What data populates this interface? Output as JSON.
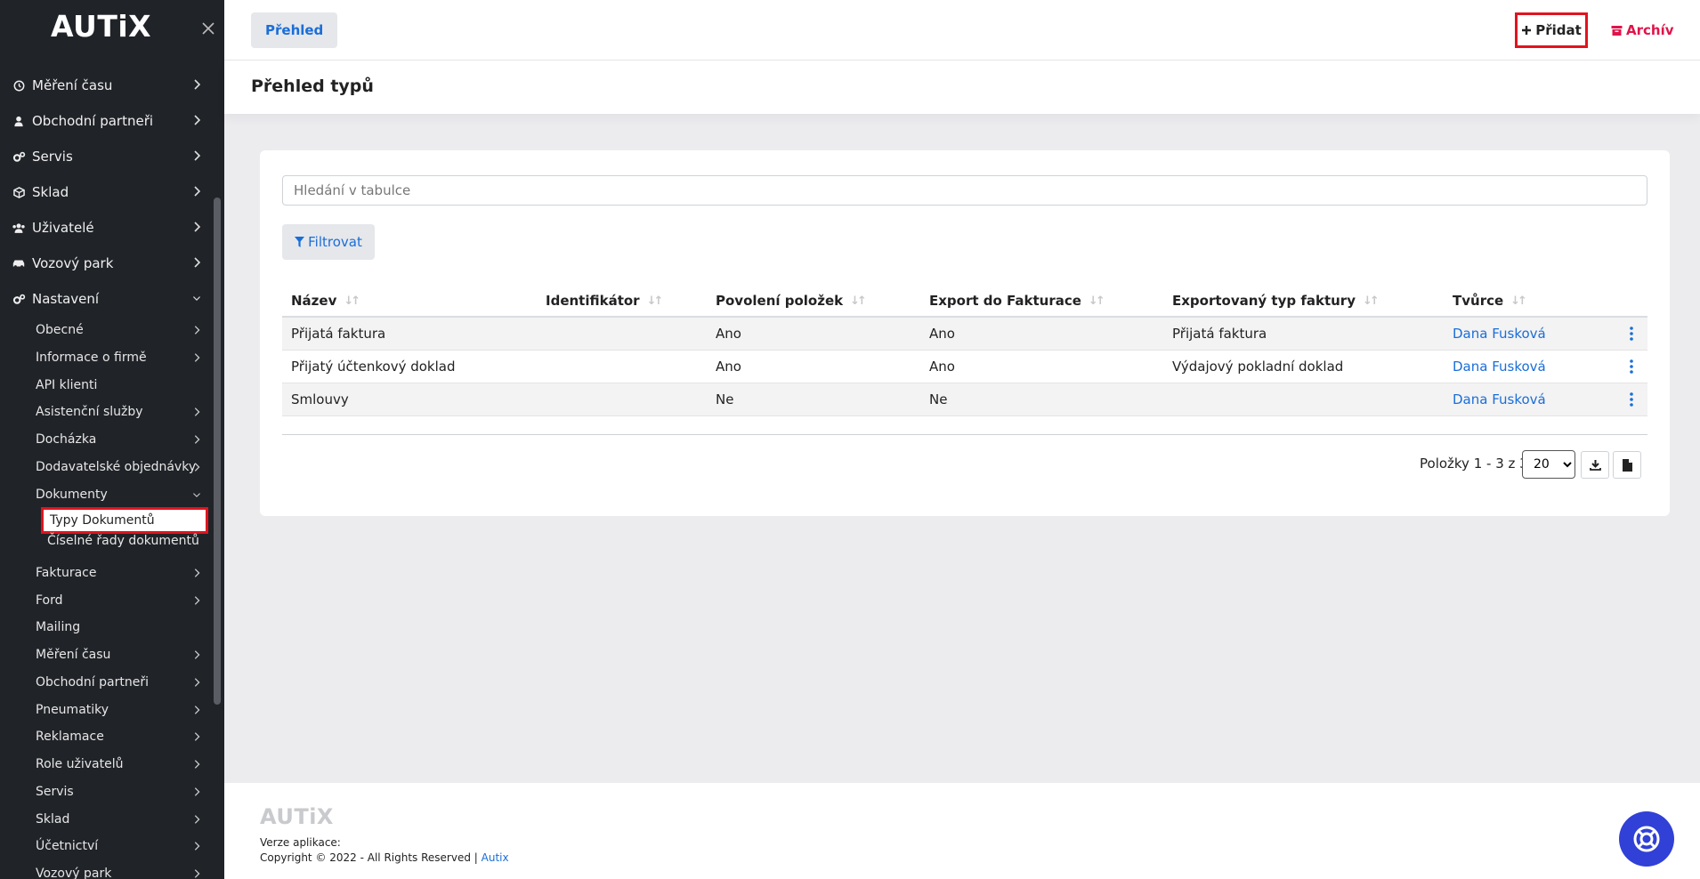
{
  "app": {
    "logo": "AUTiX"
  },
  "sidebar": {
    "items": [
      {
        "label": "Měření času",
        "icon": "clock-icon"
      },
      {
        "label": "Obchodní partneři",
        "icon": "user-icon"
      },
      {
        "label": "Servis",
        "icon": "cogs-icon"
      },
      {
        "label": "Sklad",
        "icon": "box-icon"
      },
      {
        "label": "Uživatelé",
        "icon": "users-icon"
      },
      {
        "label": "Vozový park",
        "icon": "car-icon"
      },
      {
        "label": "Nastavení",
        "icon": "cogs-icon"
      }
    ],
    "settings_sub": [
      "Obecné",
      "Informace o firmě",
      "API klienti",
      "Asistenční služby",
      "Docházka",
      "Dodavatelské objednávky",
      "Dokumenty",
      "Fakturace",
      "Ford",
      "Mailing",
      "Měření času",
      "Obchodní partneři",
      "Pneumatiky",
      "Reklamace",
      "Role uživatelů",
      "Servis",
      "Sklad",
      "Účetnictví",
      "Vozový park"
    ],
    "documents_sub": [
      "Typy Dokumentů",
      "Číselné řady dokumentů"
    ]
  },
  "topbar": {
    "tab_overview": "Přehled",
    "add_label": "Přidat",
    "archive_label": "Archív"
  },
  "page": {
    "title": "Přehled typů"
  },
  "search": {
    "placeholder": "Hledání v tabulce"
  },
  "filter_label": "Filtrovat",
  "table": {
    "columns": [
      "Název",
      "Identifikátor",
      "Povolení položek",
      "Export do Fakturace",
      "Exportovaný typ faktury",
      "Tvůrce"
    ],
    "rows": [
      {
        "name": "Přijatá faktura",
        "identifier": "",
        "allow_items": "Ano",
        "export": "Ano",
        "export_type": "Přijatá faktura",
        "creator": "Dana Fusková"
      },
      {
        "name": "Přijatý účtenkový doklad",
        "identifier": "",
        "allow_items": "Ano",
        "export": "Ano",
        "export_type": "Výdajový pokladní doklad",
        "creator": "Dana Fusková"
      },
      {
        "name": "Smlouvy",
        "identifier": "",
        "allow_items": "Ne",
        "export": "Ne",
        "export_type": "",
        "creator": "Dana Fusková"
      }
    ]
  },
  "pager": {
    "text": "Položky 1 - 3 z 3",
    "page_size": "20"
  },
  "footer": {
    "logo": "AUTiX",
    "version_label": "Verze aplikace:",
    "copyright": "Copyright © 2022 - All Rights Reserved |",
    "link": "Autix"
  },
  "colors": {
    "accent": "#1a6ed8",
    "sidebar_bg": "#202328",
    "highlight": "#e0141e",
    "archive": "#e0144a",
    "fab": "#3140d6"
  }
}
